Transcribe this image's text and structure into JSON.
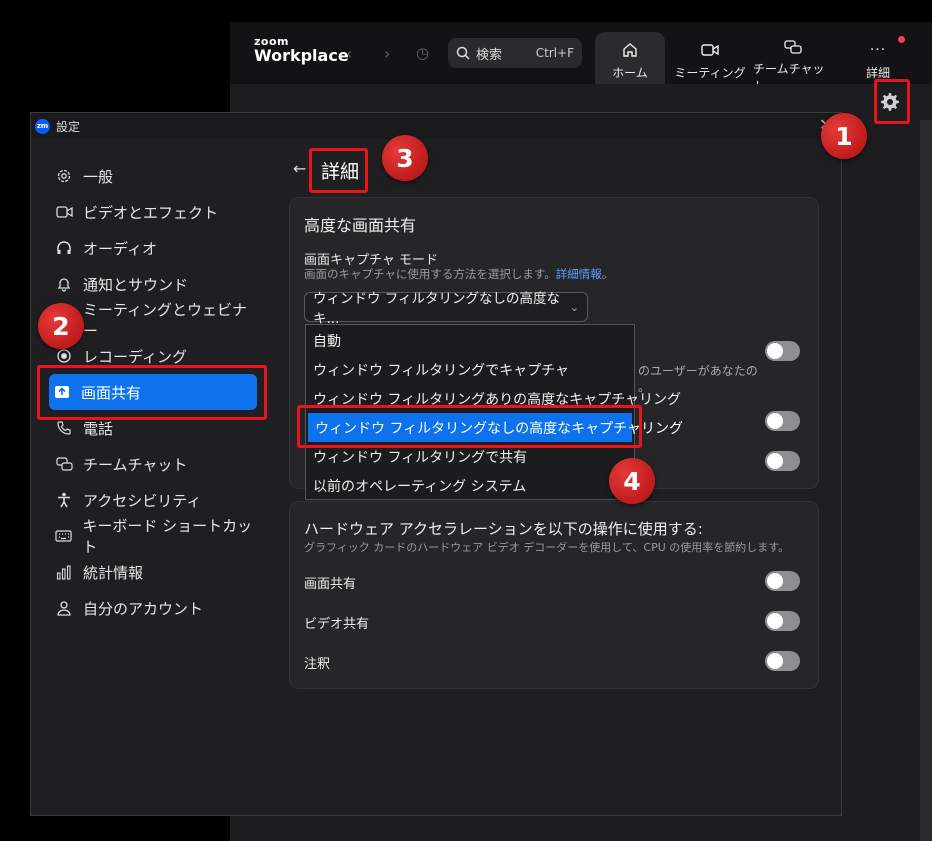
{
  "app": {
    "logo_top": "zoom",
    "logo_bottom": "Workplace",
    "search_label": "検索",
    "search_shortcut": "Ctrl+F",
    "tabs": [
      {
        "label": "ホーム",
        "icon": "home-icon",
        "active": true
      },
      {
        "label": "ミーティング",
        "icon": "video-icon",
        "active": false
      },
      {
        "label": "チームチャット",
        "icon": "chat-icon",
        "active": false
      },
      {
        "label": "詳細",
        "icon": "more-icon",
        "active": false
      }
    ]
  },
  "dialog": {
    "title": "設定",
    "close": "✕"
  },
  "sidebar": {
    "items": [
      {
        "label": "一般",
        "icon": "gear-icon"
      },
      {
        "label": "ビデオとエフェクト",
        "icon": "video-icon"
      },
      {
        "label": "オーディオ",
        "icon": "headphones-icon"
      },
      {
        "label": "通知とサウンド",
        "icon": "bell-icon"
      },
      {
        "label": "ミーティングとウェビナー",
        "icon": "meeting-icon"
      },
      {
        "label": "レコーディング",
        "icon": "record-icon"
      },
      {
        "label": "画面共有",
        "icon": "share-screen-icon",
        "active": true
      },
      {
        "label": "電話",
        "icon": "phone-icon"
      },
      {
        "label": "チームチャット",
        "icon": "chat-icon"
      },
      {
        "label": "アクセシビリティ",
        "icon": "accessibility-icon"
      },
      {
        "label": "キーボード ショートカット",
        "icon": "keyboard-icon"
      },
      {
        "label": "統計情報",
        "icon": "stats-icon"
      },
      {
        "label": "自分のアカウント",
        "icon": "user-icon"
      }
    ]
  },
  "main": {
    "back": "←",
    "title": "詳細",
    "advanced_card": {
      "title": "高度な画面共有",
      "capture_label": "画面キャプチャ モード",
      "capture_desc": "画面のキャプチャに使用する方法を選択します。",
      "capture_link": "詳細情報",
      "capture_desc_end": "。",
      "select_value": "ウィンドウ フィルタリングなしの高度なキ...",
      "partial_text_1": "のユーザーがあなたの",
      "partial_text_2": "。"
    },
    "dropdown_options": [
      {
        "label": "自動",
        "selected": false
      },
      {
        "label": "ウィンドウ フィルタリングでキャプチャ",
        "selected": false
      },
      {
        "label": "ウィンドウ フィルタリングありの高度なキャプチャリング",
        "selected": false
      },
      {
        "label": "ウィンドウ フィルタリングなしの高度なキャプチャリング",
        "selected": true
      },
      {
        "label": "ウィンドウ フィルタリングで共有",
        "selected": false
      },
      {
        "label": "以前のオペレーティング システム",
        "selected": false
      }
    ],
    "hw_card": {
      "title": "ハードウェア アクセラレーションを以下の操作に使用する:",
      "desc": "グラフィック カードのハードウェア ビデオ デコーダーを使用して、CPU の使用率を節約します。",
      "options": [
        {
          "label": "画面共有",
          "enabled": false
        },
        {
          "label": "ビデオ共有",
          "enabled": false
        },
        {
          "label": "注釈",
          "enabled": false
        }
      ]
    }
  },
  "annotations": {
    "badges": [
      "1",
      "2",
      "3",
      "4"
    ],
    "color": "#e8141e"
  }
}
